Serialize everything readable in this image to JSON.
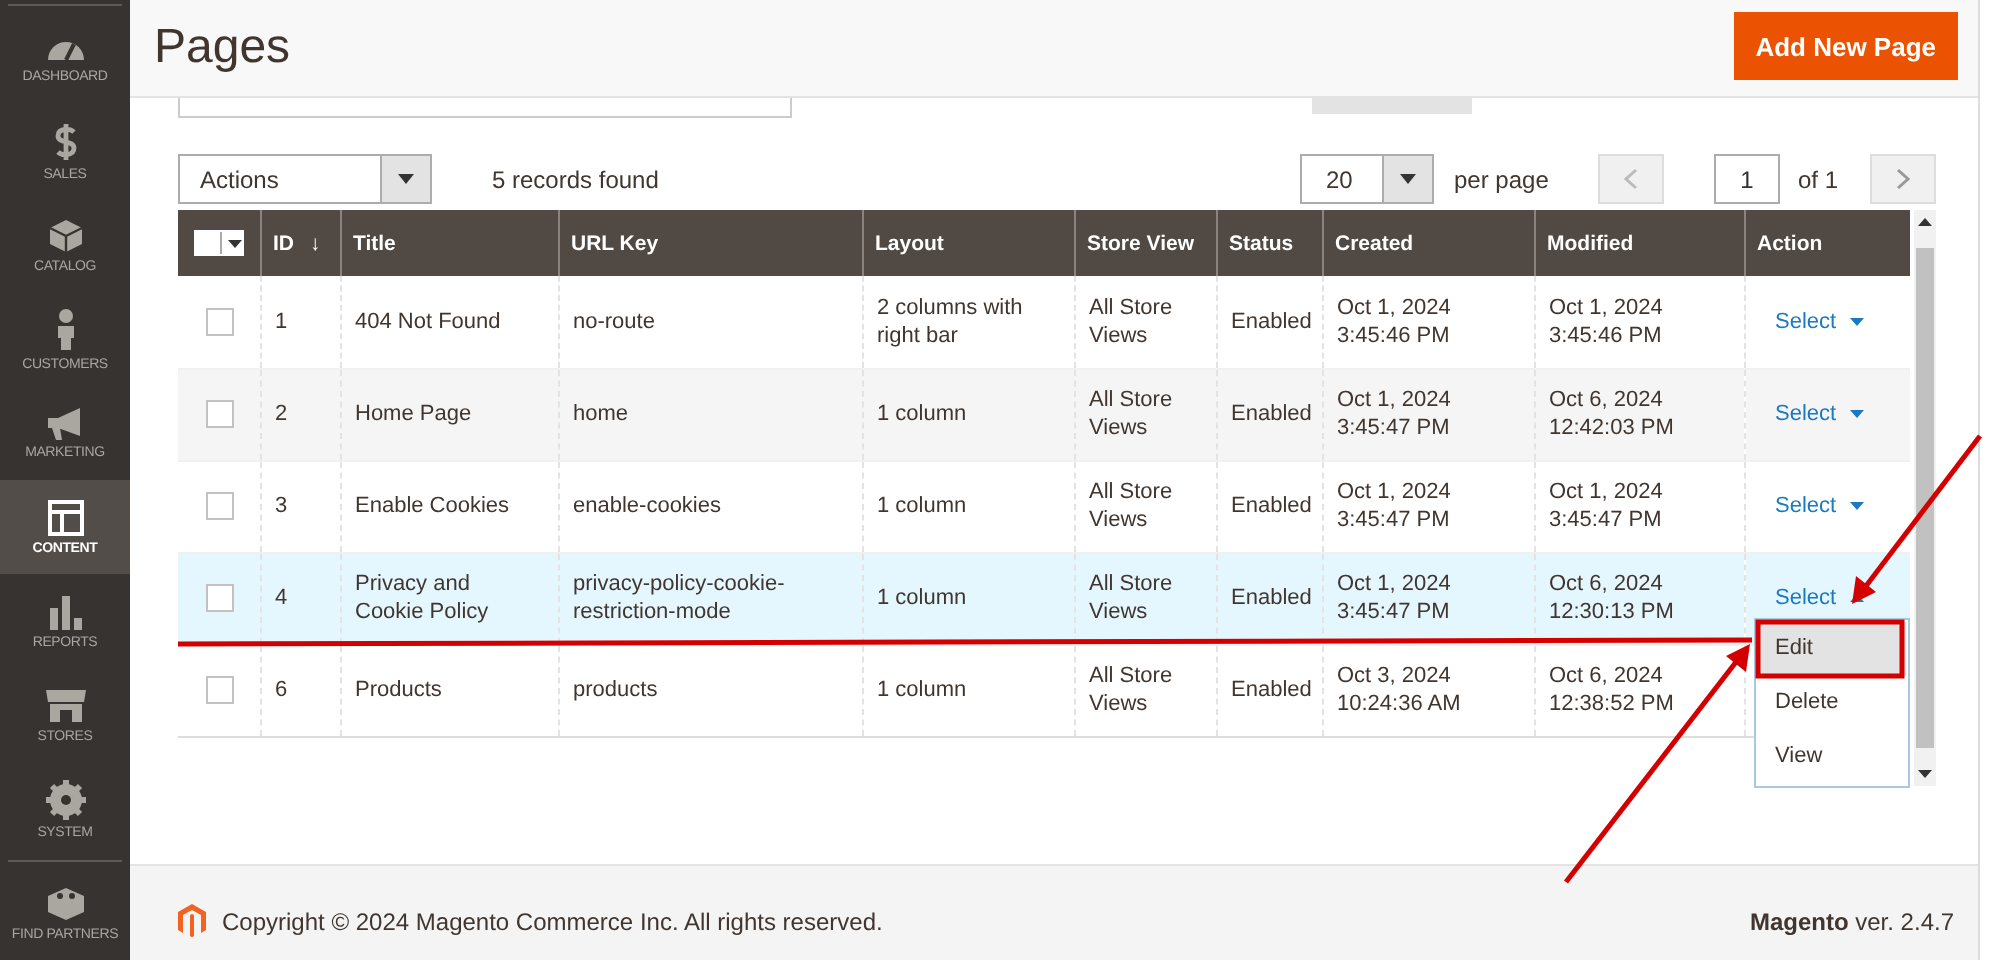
{
  "sidebar": {
    "items": [
      {
        "label": "DASHBOARD",
        "selected": false
      },
      {
        "label": "SALES",
        "selected": false
      },
      {
        "label": "CATALOG",
        "selected": false
      },
      {
        "label": "CUSTOMERS",
        "selected": false
      },
      {
        "label": "MARKETING",
        "selected": false
      },
      {
        "label": "CONTENT",
        "selected": true
      },
      {
        "label": "REPORTS",
        "selected": false
      },
      {
        "label": "STORES",
        "selected": false
      },
      {
        "label": "SYSTEM",
        "selected": false
      },
      {
        "label": "FIND PARTNERS",
        "selected": false
      }
    ]
  },
  "page": {
    "title": "Pages",
    "add_button": "Add New Page"
  },
  "toolbar": {
    "actions": "Actions",
    "records": "5 records found",
    "per_page_value": "20",
    "per_page_label": "per page",
    "page": "1",
    "of_pages": "of 1"
  },
  "table": {
    "columns": [
      "ID",
      "Title",
      "URL Key",
      "Layout",
      "Store View",
      "Status",
      "Created",
      "Modified",
      "Action"
    ],
    "sort_mark": "↓",
    "mass_select_checked": false,
    "rows": [
      {
        "checked": false,
        "selected": false,
        "expanded": false,
        "id": "1",
        "title": "404 Not Found",
        "url_key": "no-route",
        "layout": "2 columns with right bar",
        "store_view": "All Store Views",
        "status": "Enabled",
        "created": [
          "Oct 1, 2024",
          "3:45:46 PM"
        ],
        "modified": [
          "Oct 1, 2024",
          "3:45:46 PM"
        ],
        "action": "Select"
      },
      {
        "checked": false,
        "selected": false,
        "expanded": false,
        "id": "2",
        "title": "Home Page",
        "url_key": "home",
        "layout": "1 column",
        "store_view": "All Store Views",
        "status": "Enabled",
        "created": [
          "Oct 1, 2024",
          "3:45:47 PM"
        ],
        "modified": [
          "Oct 6, 2024",
          "12:42:03 PM"
        ],
        "action": "Select"
      },
      {
        "checked": false,
        "selected": false,
        "expanded": false,
        "id": "3",
        "title": "Enable Cookies",
        "url_key": "enable-cookies",
        "layout": "1 column",
        "store_view": "All Store Views",
        "status": "Enabled",
        "created": [
          "Oct 1, 2024",
          "3:45:47 PM"
        ],
        "modified": [
          "Oct 1, 2024",
          "3:45:47 PM"
        ],
        "action": "Select"
      },
      {
        "checked": false,
        "selected": true,
        "expanded": true,
        "id": "4",
        "title": "Privacy and Cookie Policy",
        "url_key": "privacy-policy-cookie-restriction-mode",
        "layout": "1 column",
        "store_view": "All Store Views",
        "status": "Enabled",
        "created": [
          "Oct 1, 2024",
          "3:45:47 PM"
        ],
        "modified": [
          "Oct 6, 2024",
          "12:30:13 PM"
        ],
        "action": "Select"
      },
      {
        "checked": false,
        "selected": false,
        "expanded": false,
        "id": "6",
        "title": "Products",
        "url_key": "products",
        "layout": "1 column",
        "store_view": "All Store Views",
        "status": "Enabled",
        "created": [
          "Oct 3, 2024",
          "10:24:36 AM"
        ],
        "modified": [
          "Oct 6, 2024",
          "12:38:52 PM"
        ]
      }
    ],
    "action_menu": [
      {
        "label": "Edit",
        "selected": true
      },
      {
        "label": "Delete",
        "selected": false
      },
      {
        "label": "View",
        "selected": false
      }
    ]
  },
  "footer": {
    "copyright": "Copyright © 2024 Magento Commerce Inc. All rights reserved.",
    "version": "**Magento** ver. 2.4.7"
  }
}
